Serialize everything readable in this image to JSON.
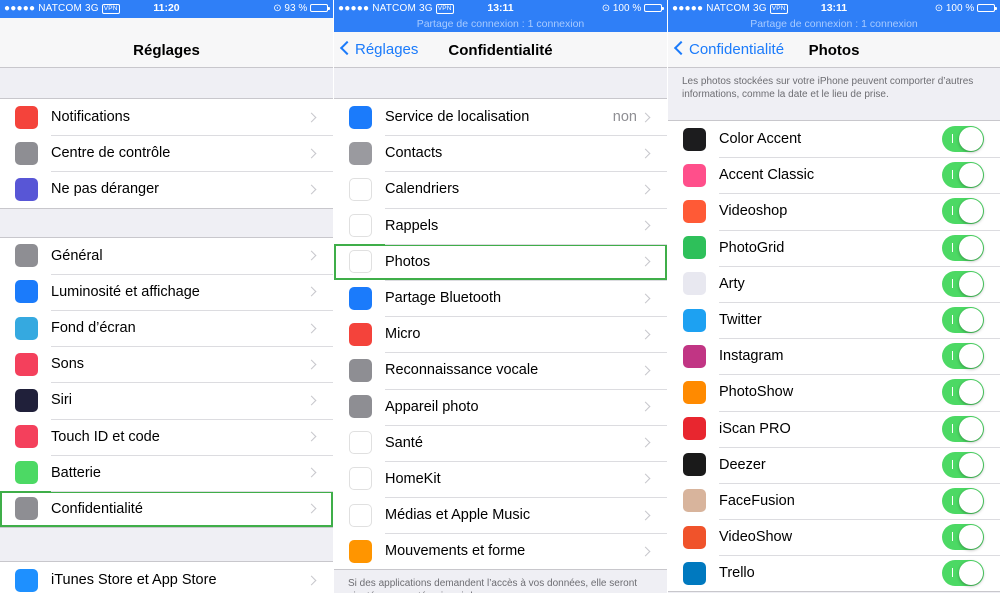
{
  "screen1": {
    "status": {
      "carrier": "NATCOM",
      "network": "3G",
      "vpn": "VPN",
      "time": "11:20",
      "battery": "93 %",
      "battery_level": 0.93
    },
    "nav": {
      "title": "Réglages"
    },
    "groups": [
      [
        {
          "label": "Notifications",
          "icon": "notifications-icon",
          "color": "#f4433b"
        },
        {
          "label": "Centre de contrôle",
          "icon": "control-center-icon",
          "color": "#8e8e93"
        },
        {
          "label": "Ne pas déranger",
          "icon": "moon-icon",
          "color": "#5856d6"
        }
      ],
      [
        {
          "label": "Général",
          "icon": "gear-icon",
          "color": "#8e8e93"
        },
        {
          "label": "Luminosité et affichage",
          "icon": "display-icon",
          "color": "#1b7bfb"
        },
        {
          "label": "Fond d’écran",
          "icon": "wallpaper-icon",
          "color": "#35a9e0"
        },
        {
          "label": "Sons",
          "icon": "speaker-icon",
          "color": "#f4405c"
        },
        {
          "label": "Siri",
          "icon": "siri-icon",
          "color": "#20203a"
        },
        {
          "label": "Touch ID et code",
          "icon": "fingerprint-icon",
          "color": "#f4405c"
        },
        {
          "label": "Batterie",
          "icon": "battery-icon",
          "color": "#4cd964"
        },
        {
          "label": "Confidentialité",
          "icon": "hand-icon",
          "color": "#8e8e93"
        }
      ],
      [
        {
          "label": "iTunes Store et App Store",
          "icon": "app-store-icon",
          "color": "#1e90ff"
        }
      ]
    ]
  },
  "screen2": {
    "status": {
      "carrier": "NATCOM",
      "network": "3G",
      "vpn": "VPN",
      "time": "13:11",
      "battery": "100 %",
      "battery_level": 1.0
    },
    "hotspot": "Partage de connexion : 1 connexion",
    "nav": {
      "back": "Réglages",
      "title": "Confidentialité"
    },
    "rows": [
      {
        "label": "Service de localisation",
        "value": "non",
        "icon": "location-arrow-icon",
        "color": "#1b7bfb"
      },
      {
        "label": "Contacts",
        "icon": "contacts-icon",
        "color": "#9a9a9f"
      },
      {
        "label": "Calendriers",
        "icon": "calendar-icon",
        "color": "#ffffff"
      },
      {
        "label": "Rappels",
        "icon": "reminders-icon",
        "color": "#ffffff"
      },
      {
        "label": "Photos",
        "icon": "photos-icon",
        "color": "#ffffff"
      },
      {
        "label": "Partage Bluetooth",
        "icon": "bluetooth-icon",
        "color": "#1b7bfb"
      },
      {
        "label": "Micro",
        "icon": "microphone-icon",
        "color": "#f4433b"
      },
      {
        "label": "Reconnaissance vocale",
        "icon": "waveform-icon",
        "color": "#8e8e93"
      },
      {
        "label": "Appareil photo",
        "icon": "camera-icon",
        "color": "#8e8e93"
      },
      {
        "label": "Santé",
        "icon": "heart-icon",
        "color": "#ffffff"
      },
      {
        "label": "HomeKit",
        "icon": "home-icon",
        "color": "#ffffff"
      },
      {
        "label": "Médias et Apple Music",
        "icon": "music-icon",
        "color": "#ffffff"
      },
      {
        "label": "Mouvements et forme",
        "icon": "motion-icon",
        "color": "#ff9500"
      }
    ],
    "footer": "Si des applications demandent l’accès à vos données, elle seront ajoutées aux catégories ci-dessus."
  },
  "screen3": {
    "status": {
      "carrier": "NATCOM",
      "network": "3G",
      "vpn": "VPN",
      "time": "13:11",
      "battery": "100 %",
      "battery_level": 1.0
    },
    "hotspot": "Partage de connexion : 1 connexion",
    "nav": {
      "back": "Confidentialité",
      "title": "Photos"
    },
    "description": "Les photos stockées sur votre iPhone peuvent comporter d’autres informations, comme la date et le lieu de prise.",
    "apps": [
      {
        "label": "Color Accent",
        "icon": "color-accent-icon",
        "color": "#1c1c1e",
        "on": true
      },
      {
        "label": "Accent Classic",
        "icon": "accent-classic-icon",
        "color": "#ff4f8b",
        "on": true
      },
      {
        "label": "Videoshop",
        "icon": "videoshop-icon",
        "color": "#ff5a36",
        "on": true
      },
      {
        "label": "PhotoGrid",
        "icon": "photogrid-icon",
        "color": "#2ec05a",
        "on": true
      },
      {
        "label": "Arty",
        "icon": "arty-icon",
        "color": "#e8e8f0",
        "on": true
      },
      {
        "label": "Twitter",
        "icon": "twitter-icon",
        "color": "#1da1f2",
        "on": true
      },
      {
        "label": "Instagram",
        "icon": "instagram-icon",
        "color": "#c13584",
        "on": true
      },
      {
        "label": "PhotoShow",
        "icon": "photoshow-icon",
        "color": "#ff8a00",
        "on": true
      },
      {
        "label": "iScan PRO",
        "icon": "iscan-icon",
        "color": "#e8262f",
        "on": true
      },
      {
        "label": "Deezer",
        "icon": "deezer-icon",
        "color": "#1a1a1a",
        "on": true
      },
      {
        "label": "FaceFusion",
        "icon": "facefusion-icon",
        "color": "#d8b49c",
        "on": true
      },
      {
        "label": "VideoShow",
        "icon": "videoshow-icon",
        "color": "#f0532b",
        "on": true
      },
      {
        "label": "Trello",
        "icon": "trello-icon",
        "color": "#0079bf",
        "on": true
      }
    ]
  }
}
